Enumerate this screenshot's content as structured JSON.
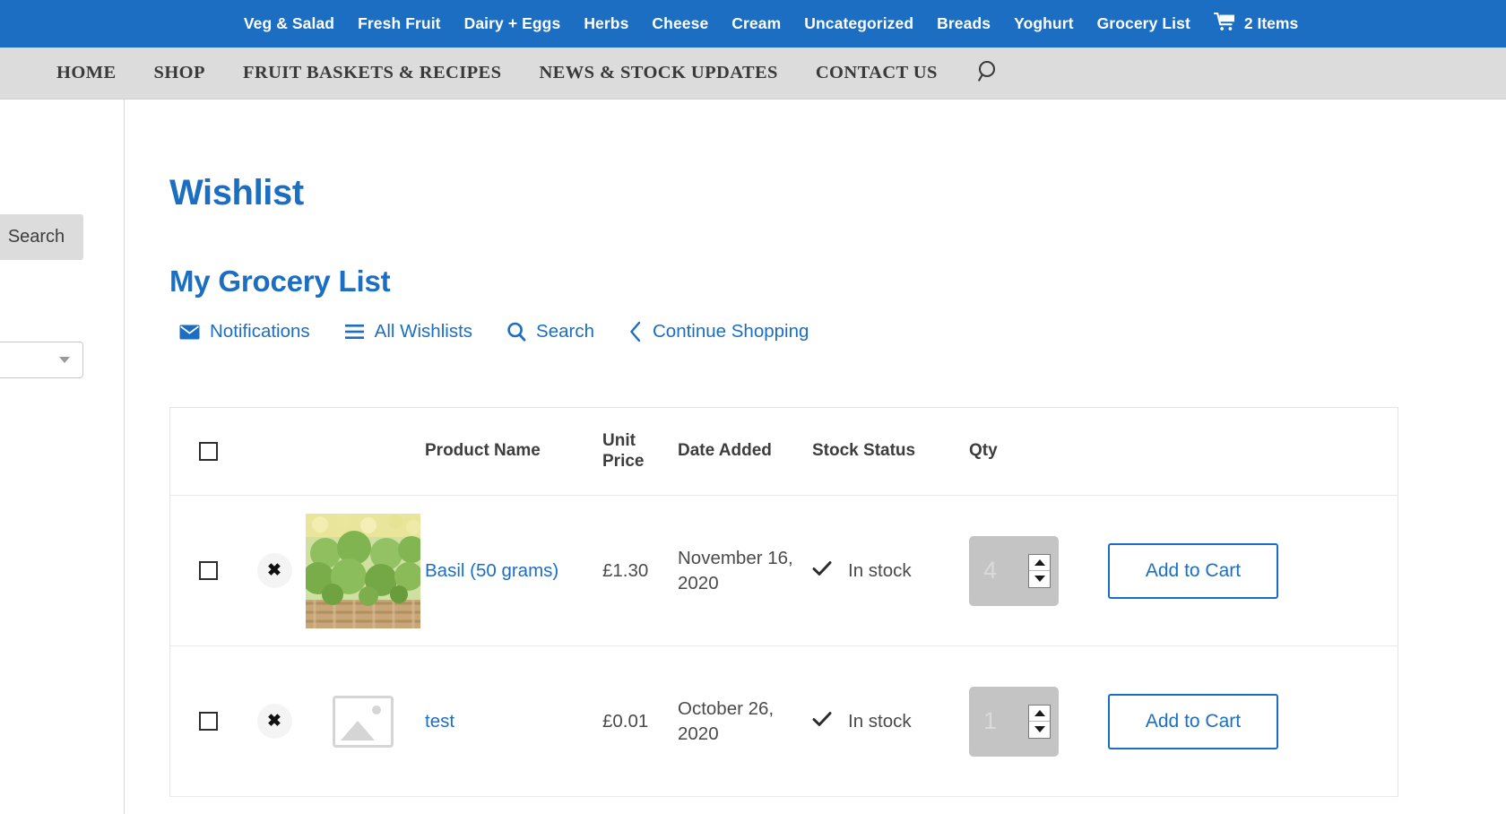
{
  "topbar": {
    "items": [
      {
        "label": "Veg & Salad"
      },
      {
        "label": "Fresh Fruit"
      },
      {
        "label": "Dairy + Eggs"
      },
      {
        "label": "Herbs"
      },
      {
        "label": "Cheese"
      },
      {
        "label": "Cream"
      },
      {
        "label": "Uncategorized"
      },
      {
        "label": "Breads"
      },
      {
        "label": "Yoghurt"
      },
      {
        "label": "Grocery List"
      }
    ],
    "cart": {
      "icon": "shopping-cart-icon",
      "count_label": "2 Items"
    },
    "background": "#1b6ec2",
    "text_color": "#ffffff"
  },
  "mainnav": {
    "items": [
      {
        "label": "HOME"
      },
      {
        "label": "SHOP"
      },
      {
        "label": "FRUIT BASKETS & RECIPES"
      },
      {
        "label": "NEWS & STOCK UPDATES"
      },
      {
        "label": "CONTACT US"
      }
    ],
    "search_icon": "search-icon",
    "background": "#dcdcdc"
  },
  "left_rail": {
    "search_button_label": "Search",
    "select_value": ""
  },
  "page": {
    "title": "Wishlist",
    "list_title": "My Grocery List",
    "accent_color": "#1b6ec2"
  },
  "actions": [
    {
      "label": "Notifications",
      "icon": "envelope-icon"
    },
    {
      "label": "All Wishlists",
      "icon": "hamburger-list-icon"
    },
    {
      "label": "Search",
      "icon": "search-icon"
    },
    {
      "label": "Continue Shopping",
      "icon": "chevron-left-icon"
    }
  ],
  "table": {
    "headers": {
      "select_all": "",
      "remove": "",
      "thumb": "",
      "product_name": "Product Name",
      "unit_price": "Unit Price",
      "date_added": "Date Added",
      "stock_status": "Stock Status",
      "qty": "Qty",
      "action": ""
    },
    "rows": [
      {
        "selected": false,
        "remove_label": "✖",
        "thumb_type": "product-photo",
        "product_name": "Basil (50 grams)",
        "unit_price": "£1.30",
        "date_added": "November 16, 2020",
        "stock_status": "In stock",
        "stock_icon": "check-icon",
        "qty": "4",
        "add_to_cart_label": "Add to Cart"
      },
      {
        "selected": false,
        "remove_label": "✖",
        "thumb_type": "placeholder",
        "product_name": "test",
        "unit_price": "£0.01",
        "date_added": "October 26, 2020",
        "stock_status": "In stock",
        "stock_icon": "check-icon",
        "qty": "1",
        "add_to_cart_label": "Add to Cart"
      }
    ]
  }
}
